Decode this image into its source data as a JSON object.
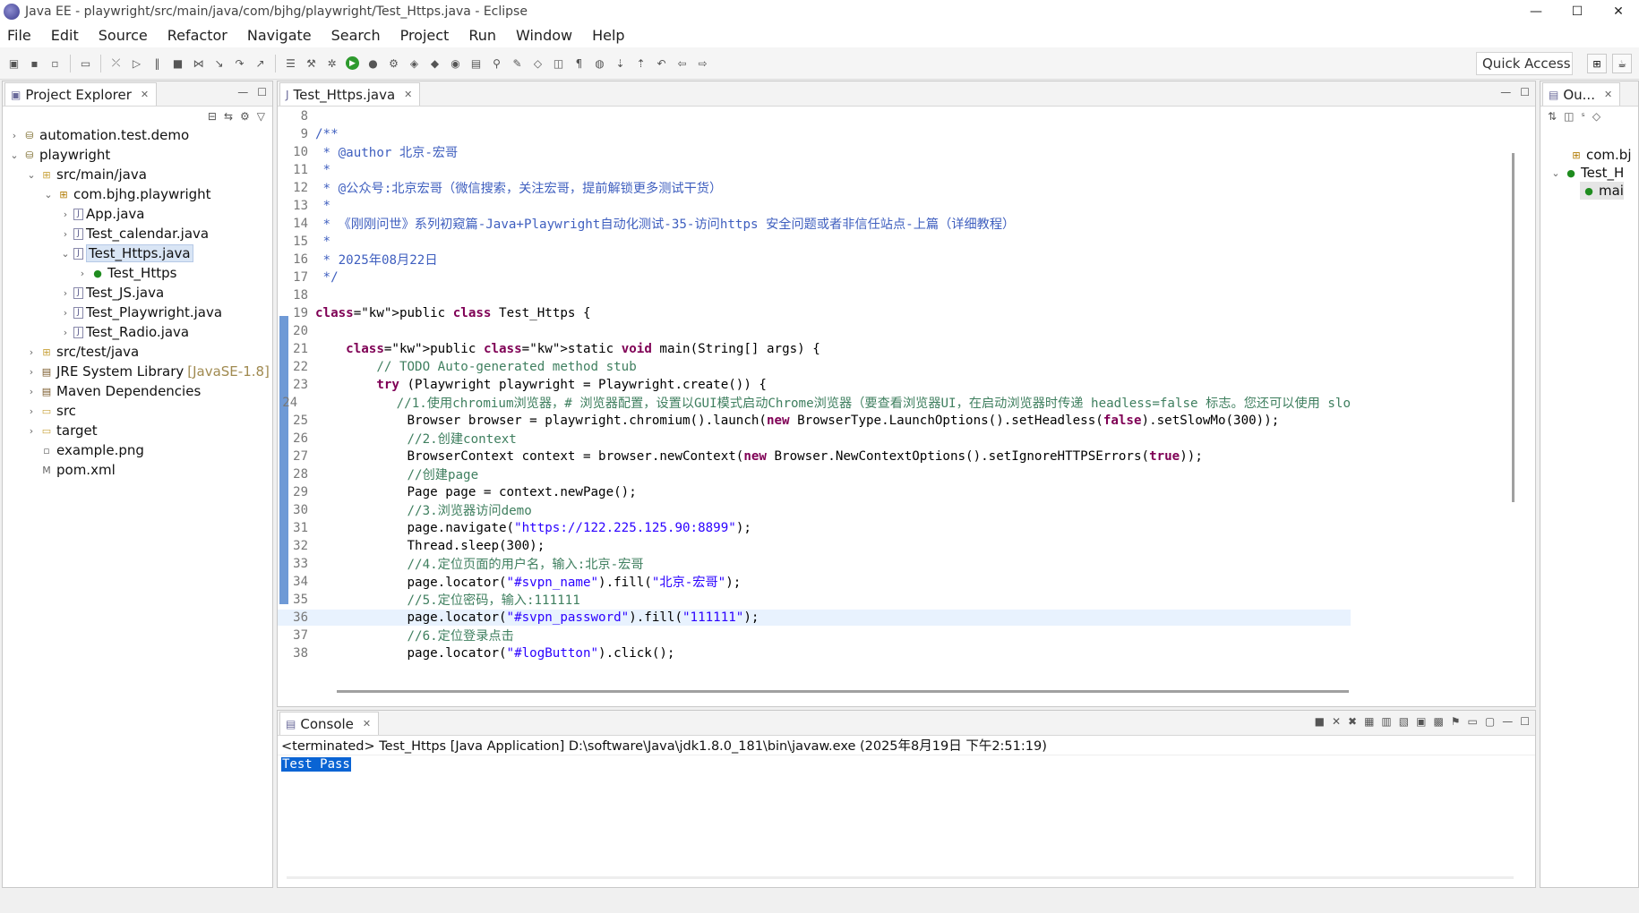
{
  "window": {
    "title": "Java EE - playwright/src/main/java/com/bjhg/playwright/Test_Https.java - Eclipse"
  },
  "menu": [
    "File",
    "Edit",
    "Source",
    "Refactor",
    "Navigate",
    "Search",
    "Project",
    "Run",
    "Window",
    "Help"
  ],
  "toolbar": {
    "quick_access": "Quick Access"
  },
  "project_explorer": {
    "tab_label": "Project Explorer",
    "items": [
      {
        "label": "automation.test.demo",
        "icon": "project-icon",
        "twisty": "›"
      },
      {
        "label": "playwright",
        "icon": "project-icon",
        "twisty": "⌄"
      },
      {
        "label": "src/main/java",
        "icon": "source-folder-icon",
        "twisty": "⌄"
      },
      {
        "label": "com.bjhg.playwright",
        "icon": "package-icon",
        "twisty": "⌄"
      },
      {
        "label": "App.java",
        "icon": "java-file-icon",
        "twisty": "›"
      },
      {
        "label": "Test_calendar.java",
        "icon": "java-file-icon",
        "twisty": "›"
      },
      {
        "label": "Test_Https.java",
        "icon": "java-file-icon",
        "twisty": "⌄"
      },
      {
        "label": "Test_Https",
        "icon": "class-icon",
        "twisty": "›"
      },
      {
        "label": "Test_JS.java",
        "icon": "java-file-icon",
        "twisty": "›"
      },
      {
        "label": "Test_Playwright.java",
        "icon": "java-file-icon",
        "twisty": "›"
      },
      {
        "label": "Test_Radio.java",
        "icon": "java-file-icon",
        "twisty": "›"
      },
      {
        "label": "src/test/java",
        "icon": "source-folder-icon",
        "twisty": "›"
      },
      {
        "label": "JRE System Library",
        "icon": "library-icon",
        "twisty": "›",
        "tag": "[JavaSE-1.8]"
      },
      {
        "label": "Maven Dependencies",
        "icon": "library-icon",
        "twisty": "›"
      },
      {
        "label": "src",
        "icon": "folder-icon",
        "twisty": "›"
      },
      {
        "label": "target",
        "icon": "folder-icon",
        "twisty": "›"
      },
      {
        "label": "example.png",
        "icon": "file-icon",
        "twisty": ""
      },
      {
        "label": "pom.xml",
        "icon": "xml-file-icon",
        "twisty": ""
      }
    ]
  },
  "editor": {
    "tab_label": "Test_Https.java",
    "lines": [
      {
        "n": "8",
        "t": ""
      },
      {
        "n": "9",
        "t": "/**",
        "c": "cm"
      },
      {
        "n": "10",
        "t": " * @author 北京-宏哥",
        "c": "cm"
      },
      {
        "n": "11",
        "t": " *",
        "c": "cm"
      },
      {
        "n": "12",
        "t": " * @公众号:北京宏哥（微信搜索，关注宏哥，提前解锁更多测试干货）",
        "c": "cm"
      },
      {
        "n": "13",
        "t": " *",
        "c": "cm"
      },
      {
        "n": "14",
        "t": " * 《刚刚问世》系列初窥篇-Java+Playwright自动化测试-35-访问https 安全问题或者非信任站点-上篇（详细教程）",
        "c": "cm"
      },
      {
        "n": "15",
        "t": " *",
        "c": "cm"
      },
      {
        "n": "16",
        "t": " * 2025年08月22日",
        "c": "cm"
      },
      {
        "n": "17",
        "t": " */",
        "c": "cm"
      },
      {
        "n": "18",
        "t": ""
      },
      {
        "n": "19",
        "t": "public class Test_Https {"
      },
      {
        "n": "20",
        "t": ""
      },
      {
        "n": "21",
        "t": "    public static void main(String[] args) {"
      },
      {
        "n": "22",
        "t": "        // TODO Auto-generated method stub",
        "c": "lc"
      },
      {
        "n": "23",
        "t": "        try (Playwright playwright = Playwright.create()) {"
      },
      {
        "n": "24",
        "t": "            //1.使用chromium浏览器，# 浏览器配置，设置以GUI模式启动Chrome浏览器（要查看浏览器UI，在启动浏览器时传递 headless=false 标志。您还可以使用 slo",
        "c": "lc"
      },
      {
        "n": "25",
        "t": "            Browser browser = playwright.chromium().launch(new BrowserType.LaunchOptions().setHeadless(false).setSlowMo(300));"
      },
      {
        "n": "26",
        "t": "            //2.创建context",
        "c": "lc"
      },
      {
        "n": "27",
        "t": "            BrowserContext context = browser.newContext(new Browser.NewContextOptions().setIgnoreHTTPSErrors(true));"
      },
      {
        "n": "28",
        "t": "            //创建page",
        "c": "lc"
      },
      {
        "n": "29",
        "t": "            Page page = context.newPage();"
      },
      {
        "n": "30",
        "t": "            //3.浏览器访问demo",
        "c": "lc"
      },
      {
        "n": "31",
        "t": "            page.navigate(\"https://122.225.125.90:8899\");"
      },
      {
        "n": "32",
        "t": "            Thread.sleep(300);"
      },
      {
        "n": "33",
        "t": "            //4.定位页面的用户名，输入:北京-宏哥",
        "c": "lc"
      },
      {
        "n": "34",
        "t": "            page.locator(\"#svpn_name\").fill(\"北京-宏哥\");"
      },
      {
        "n": "35",
        "t": "            //5.定位密码，输入:111111",
        "c": "lc"
      },
      {
        "n": "36",
        "t": "            page.locator(\"#svpn_password\").fill(\"111111\");"
      },
      {
        "n": "37",
        "t": "            //6.定位登录点击",
        "c": "lc"
      },
      {
        "n": "38",
        "t": "            page.locator(\"#logButton\").click();"
      }
    ]
  },
  "console": {
    "tab_label": "Console",
    "status": "<terminated> Test_Https [Java Application] D:\\software\\Java\\jdk1.8.0_181\\bin\\javaw.exe (2025年8月19日 下午2:51:19)",
    "output": "Test Pass"
  },
  "outline": {
    "tab_label": "Ou...",
    "items": [
      {
        "label": "com.bj"
      },
      {
        "label": "Test_H"
      },
      {
        "label": "mai"
      }
    ]
  }
}
